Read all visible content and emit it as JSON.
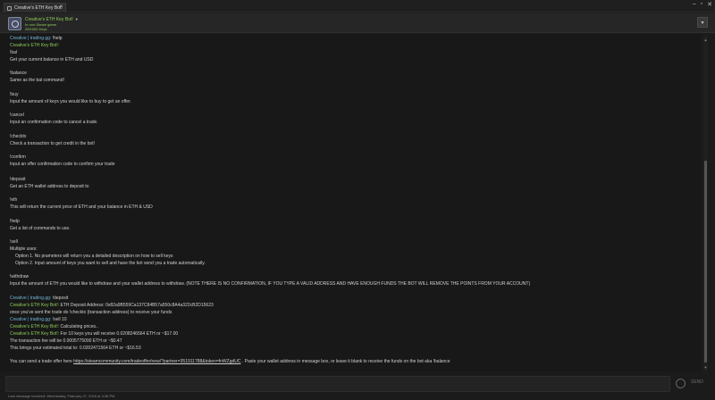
{
  "window": {
    "tab_title": "Creative's ETH Key Bot!",
    "tab_close": "×",
    "minimize": "‒",
    "maximize": "▫",
    "close": "✕"
  },
  "header": {
    "name": "Creative's ETH Key Bot!",
    "status": "In non-Steam game",
    "keys": "29/1000 Keys",
    "dropdown_icon": "▾"
  },
  "chat": {
    "lines": [
      {
        "author": "Creative | trading.gg",
        "text": "!help"
      },
      {
        "bot": "Creative's ETH Key Bot!",
        "text": ""
      },
      {
        "text": "!bal"
      },
      {
        "text": "Get your current balance in ETH and USD"
      },
      {
        "text": "!balance"
      },
      {
        "text": "Same as the bal command!"
      },
      {
        "text": "!buy"
      },
      {
        "text": "Input the amount of keys you would like to buy to get an offer."
      },
      {
        "text": "!cancel"
      },
      {
        "text": "Input an confirmation code to cancel a trade."
      },
      {
        "text": "!checktx"
      },
      {
        "text": "Check a transaction to get credit in the bot!"
      },
      {
        "text": "!confirm"
      },
      {
        "text": "Input an offer confirmation code to confirm your trade"
      },
      {
        "text": "!deposit"
      },
      {
        "text": "Get an ETH wallet address to deposit to"
      },
      {
        "text": "!eth"
      },
      {
        "text": "This will return the current price of ETH and your balance in ETH & USD"
      },
      {
        "text": "!help"
      },
      {
        "text": "Get a list of commands to use."
      },
      {
        "text": "!sell"
      },
      {
        "text": "Multiple uses:"
      },
      {
        "text": "Option 1. No prameters will return you a detailed description on how to sell keys"
      },
      {
        "text": "Option 2. Input amount of keys you want to sell and have the bot send you a trade automatically."
      },
      {
        "text": "!withdraw"
      },
      {
        "text": "Input the amount of ETH you would like to withdraw and your wallet address to withdraw. (NOTE THERE IS NO CONFIRMATION, IF YOU TYPE A VALID ADDRESS AND HAVE ENOUGH FUNDS THE BOT WILL REMOVE THE POINTS FROM YOUR ACCOUNT)"
      },
      {
        "author": "Creative | trading.gg",
        "text": "!deposit"
      },
      {
        "bot": "Creative's ETH Key Bot!",
        "text": "ETH Deposit Address: 0x82a9B559Ca137C84B57a550c8A4a322cB2D15623"
      },
      {
        "text": "once you've sent the trade do !checktx {transaction address} to receive your funds"
      },
      {
        "author": "Creative | trading.gg",
        "text": "!sell 10"
      },
      {
        "bot": "Creative's ETH Key Bot!",
        "text": "Calculating prices.."
      },
      {
        "bot": "Creative's ETH Key Bot!",
        "text": "For 10 keys you will receive 0.0208246564 ETH or ~$17.00"
      },
      {
        "text": "The transaction fee will be 0.0005775000 ETH or ~$0.47"
      },
      {
        "text": "This brings your estimated total to: 0.0202471564 ETH or ~$16.53"
      }
    ],
    "final_pre": "You can send a trade offer here",
    "final_link": "https://steamcommunity.com/tradeoffer/new/?partner=351911788&token=fnWZgdUC",
    "final_post": ". Paste your wallet address in message box, or leave it blank to receive the funds on the bot aka !balance"
  },
  "scrollbar": {
    "up": "▲",
    "down": "▼"
  },
  "footer": {
    "send_label": "SEND",
    "last_message": "Last message received: Wednesday, February 07, 2018 at 3:38 PM"
  }
}
